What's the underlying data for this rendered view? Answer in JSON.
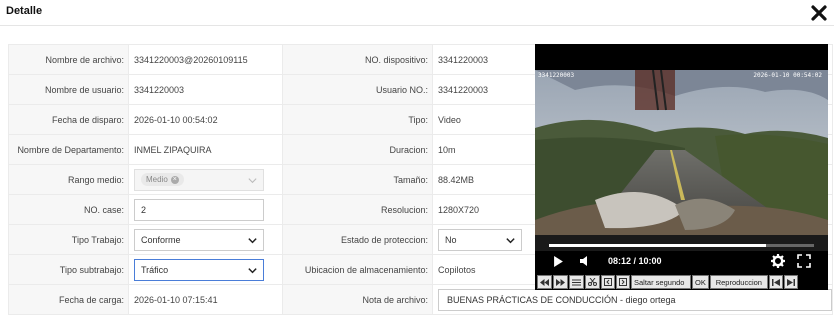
{
  "dialog": {
    "title": "Detalle",
    "close_icon": "close-x-icon"
  },
  "rows": {
    "file_name": {
      "label": "Nombre de archivo:",
      "value": "3341220003@20260109115"
    },
    "user_name": {
      "label": "Nombre de usuario:",
      "value": "3341220003"
    },
    "trigger_date": {
      "label": "Fecha de disparo:",
      "value": "2026-01-10 00:54:02"
    },
    "department": {
      "label": "Nombre de Departamento:",
      "value": "INMEL ZIPAQUIRA"
    },
    "mid_range": {
      "label": "Rango medio:",
      "tag": "Medio"
    },
    "case_no": {
      "label": "NO. case:",
      "value": "2"
    },
    "work_type": {
      "label": "Tipo Trabajo:",
      "value": "Conforme"
    },
    "subwork_type": {
      "label": "Tipo subtrabajo:",
      "value": "Tráfico"
    },
    "upload_date": {
      "label": "Fecha de carga:",
      "value": "2026-01-10 07:15:41"
    },
    "device_no": {
      "label": "NO. dispositivo:",
      "value": "3341220003"
    },
    "user_no": {
      "label": "Usuario NO.:",
      "value": "3341220003"
    },
    "type": {
      "label": "Tipo:",
      "value": "Video"
    },
    "duration": {
      "label": "Duracion:",
      "value": "10m"
    },
    "size": {
      "label": "Tamaño:",
      "value": "88.42MB"
    },
    "resolution": {
      "label": "Resolucion:",
      "value": "1280X720"
    },
    "protection": {
      "label": "Estado de proteccion:",
      "value": "No"
    },
    "storage": {
      "label": "Ubicacion de almacenamiento:",
      "value": "Copilotos"
    },
    "file_note": {
      "label": "Nota de archivo:",
      "value": "BUENAS PRÁCTICAS DE CONDUCCIÓN - diego ortega"
    }
  },
  "player": {
    "osd_left": "3341220003",
    "osd_right": "2026-01-10 00:54:02",
    "current_time": "08:12",
    "total_time": "10:00",
    "time_label": "08:12 / 10:00",
    "progress": 0.82,
    "icons": [
      "play-icon",
      "volume-icon",
      "settings-icon",
      "fullscreen-icon"
    ]
  },
  "toolbar": {
    "buttons": [
      "prev-icon",
      "next-icon",
      "list-icon",
      "cut-icon",
      "frame-back-icon",
      "frame-forward-icon"
    ],
    "skip_placeholder": "Saltar segundo",
    "ok_label": "OK",
    "playback_label": "Reproduccion",
    "end_buttons": [
      "skip-start-icon",
      "skip-end-icon"
    ]
  },
  "colors": {
    "focus_border": "#4a7dd8",
    "label_bg": "#f7f7f7",
    "border": "#ebebeb"
  }
}
